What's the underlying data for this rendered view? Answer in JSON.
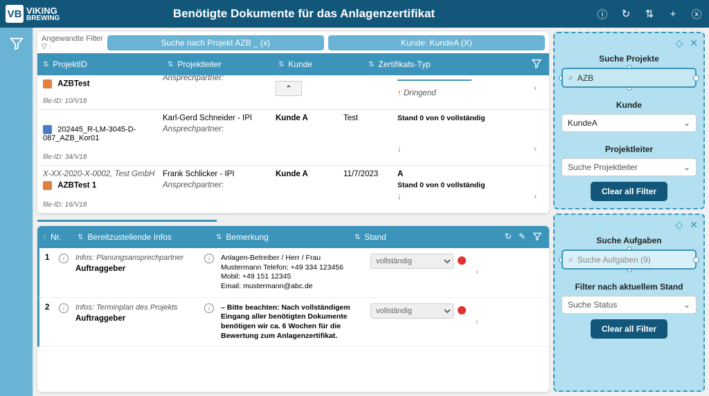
{
  "header": {
    "brand1": "VIKING",
    "brand2": "BREWING",
    "title": "Benötigte Dokumente für das Anlagenzertifikat"
  },
  "filters": {
    "label": "Angewandte Filter",
    "pill1": "Suche nach Projekt AZB _ (x)",
    "pill2": "Kunde: KundeA (X)"
  },
  "proj_headers": {
    "c1": "ProjektID",
    "c2": "Projektleiter",
    "c3": "Kunde",
    "c4": "Zertifikats-Typ"
  },
  "projects": [
    {
      "name": "AZBTest",
      "file_id": "file-ID: 10/V18",
      "ansprech": "Ansprechpartner:",
      "urgent": "Dringend",
      "icon": "orange"
    },
    {
      "name": "202445_R-LM-3045-D-087_AZB_Kor01",
      "file_id": "file-ID: 34/V18",
      "leiter": "Karl-Gerd Schneider - IPI",
      "ansprech": "Ansprechpartner:",
      "kunde": "Kunde A",
      "typ": "Test",
      "status": "Stand 0 von 0 vollständig",
      "icon": "blue"
    },
    {
      "title_line": "X-XX-2020-X-0002, Test GmbH",
      "name": "AZBTest 1",
      "file_id": "file-ID: 16/V18",
      "leiter": "Frank Schlicker - IPI",
      "ansprech": "Ansprechpartner:",
      "kunde": "Kunde A",
      "date": "11/7/2023",
      "typ": "A",
      "status": "Stand 0 von 0 vollständig",
      "icon": "orange"
    }
  ],
  "task_headers": {
    "nr": "Nr.",
    "info": "Bereitzustellende Infos",
    "bem": "Bemerkung",
    "stand": "Stand"
  },
  "tasks": [
    {
      "nr": "1",
      "info_sub": "Infos: Planungsansprechpartner",
      "info_main": "Auftraggeber",
      "bem": "Anlagen-Betreiber  / Herr / Frau\nMustermann Telefon: +49 334 123456\nMobil: +49 151 12345\nEmail: mustermann@abc.de",
      "stand": "vollständig"
    },
    {
      "nr": "2",
      "info_sub": "Infos: Terminplan des Projekts",
      "info_main": "Auftraggeber",
      "bem_bold": "– Bitte beachten: Nach vollständigem Eingang aller benötigten Dokumente benötigen wir ca. 6 Wochen für die Bewertung zum Anlagenzertifikat.",
      "stand": "vollständig"
    }
  ],
  "panel_proj": {
    "title": "Suche Projekte",
    "search_value": "AZB",
    "kunde_label": "Kunde",
    "kunde_value": "KundeA",
    "leiter_label": "Projektleiter",
    "leiter_placeholder": "Suche Projektleiter",
    "clear": "Clear all Filter"
  },
  "panel_task": {
    "title": "Suche Aufgaben",
    "search_placeholder": "Suche Aufgaben (9)",
    "filter_label": "Filter nach aktuellem Stand",
    "status_placeholder": "Suche Status",
    "clear": "Clear all Filter"
  }
}
